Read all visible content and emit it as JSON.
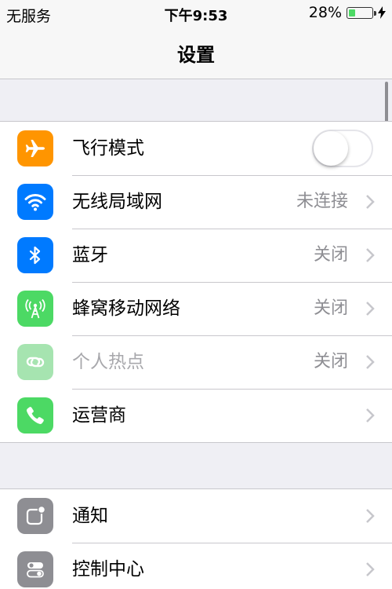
{
  "status_bar": {
    "carrier": "无服务",
    "time": "下午9:53",
    "battery_percent": "28%",
    "battery_level": 0.28,
    "battery_color": "#4cd964",
    "charging_icon": "bolt-icon"
  },
  "nav": {
    "title": "设置"
  },
  "groups": [
    {
      "rows": [
        {
          "icon": "airplane-icon",
          "icon_bg": "#ff9500",
          "label": "飞行模式",
          "control": "toggle",
          "toggle_on": false
        },
        {
          "icon": "wifi-icon",
          "icon_bg": "#007aff",
          "label": "无线局域网",
          "value": "未连接"
        },
        {
          "icon": "bluetooth-icon",
          "icon_bg": "#007aff",
          "label": "蓝牙",
          "value": "关闭"
        },
        {
          "icon": "cellular-icon",
          "icon_bg": "#4cd964",
          "label": "蜂窝移动网络",
          "value": "关闭"
        },
        {
          "icon": "hotspot-icon",
          "icon_bg": "#a6e4b0",
          "label": "个人热点",
          "value": "关闭",
          "disabled": true
        },
        {
          "icon": "phone-icon",
          "icon_bg": "#4cd964",
          "label": "运营商",
          "value": ""
        }
      ]
    },
    {
      "rows": [
        {
          "icon": "notifications-icon",
          "icon_bg": "#8e8e93",
          "label": "通知",
          "value": ""
        },
        {
          "icon": "control-center-icon",
          "icon_bg": "#8e8e93",
          "label": "控制中心",
          "value": ""
        }
      ]
    }
  ]
}
